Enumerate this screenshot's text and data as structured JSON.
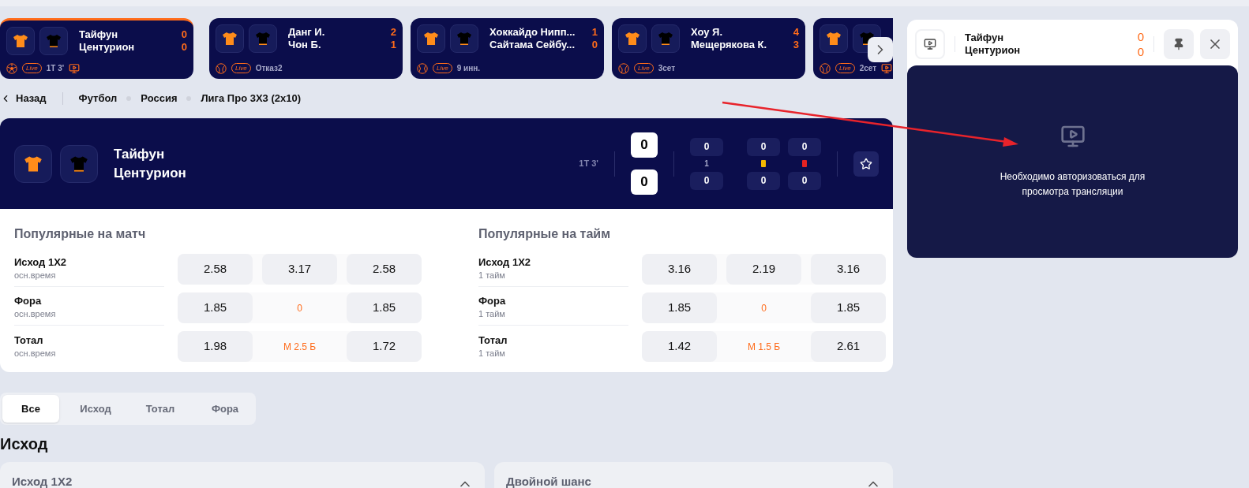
{
  "ticker": [
    {
      "home": "Тайфун",
      "away": "Центурион",
      "home_score": "0",
      "away_score": "0",
      "kind": "football",
      "live": "Live",
      "status": "1T 3'",
      "tv": true,
      "selected": true
    },
    {
      "home": "Данг И.",
      "away": "Чон Б.",
      "home_score": "2",
      "away_score": "1",
      "kind": "tennis",
      "live": "Live",
      "status": "Отказ2",
      "tv": false,
      "selected": false
    },
    {
      "home": "Хоккайдо Нипп...",
      "away": "Сайтама Сейбу...",
      "home_score": "1",
      "away_score": "0",
      "kind": "baseball",
      "live": "Live",
      "status": "9 инн.",
      "tv": false,
      "selected": false
    },
    {
      "home": "Хоу Я.",
      "away": "Мещерякова К.",
      "home_score": "4",
      "away_score": "3",
      "kind": "tennis",
      "live": "Live",
      "status": "3сет",
      "tv": false,
      "selected": false
    },
    {
      "kind": "tennis",
      "live": "Live",
      "status": "2сет",
      "tv": true,
      "selected": false
    }
  ],
  "breadcrumb": {
    "back": "Назад",
    "items": [
      "Футбол",
      "Россия",
      "Лига Про 3Х3 (2х10)"
    ]
  },
  "match": {
    "home": "Тайфун",
    "away": "Центурион",
    "time": "1T 3'",
    "home_score": "0",
    "away_score": "0",
    "stats": [
      {
        "kind": "text",
        "label": "1",
        "home": "0",
        "away": "0"
      },
      {
        "kind": "card",
        "color": "#f5b800",
        "home": "0",
        "away": "0"
      },
      {
        "kind": "card",
        "color": "#e52222",
        "home": "0",
        "away": "0"
      }
    ]
  },
  "popular": [
    {
      "title": "Популярные на матч",
      "rows": [
        {
          "market": "Исход 1X2",
          "period": "осн.время",
          "odds": [
            {
              "kind": "odd",
              "value": "2.58"
            },
            {
              "kind": "odd",
              "value": "3.17"
            },
            {
              "kind": "odd",
              "value": "2.58"
            }
          ]
        },
        {
          "market": "Фора",
          "period": "осн.время",
          "odds": [
            {
              "kind": "odd",
              "value": "1.85"
            },
            {
              "kind": "line",
              "value": "0"
            },
            {
              "kind": "odd",
              "value": "1.85"
            }
          ]
        },
        {
          "market": "Тотал",
          "period": "осн.время",
          "odds": [
            {
              "kind": "odd",
              "value": "1.98"
            },
            {
              "kind": "line",
              "value": "М 2.5 Б"
            },
            {
              "kind": "odd",
              "value": "1.72"
            }
          ]
        }
      ]
    },
    {
      "title": "Популярные на тайм",
      "rows": [
        {
          "market": "Исход 1X2",
          "period": "1 тайм",
          "odds": [
            {
              "kind": "odd",
              "value": "3.16"
            },
            {
              "kind": "odd",
              "value": "2.19"
            },
            {
              "kind": "odd",
              "value": "3.16"
            }
          ]
        },
        {
          "market": "Фора",
          "period": "1 тайм",
          "odds": [
            {
              "kind": "odd",
              "value": "1.85"
            },
            {
              "kind": "line",
              "value": "0"
            },
            {
              "kind": "odd",
              "value": "1.85"
            }
          ]
        },
        {
          "market": "Тотал",
          "period": "1 тайм",
          "odds": [
            {
              "kind": "odd",
              "value": "1.42"
            },
            {
              "kind": "line",
              "value": "М 1.5 Б"
            },
            {
              "kind": "odd",
              "value": "2.61"
            }
          ]
        }
      ]
    }
  ],
  "tabs": [
    {
      "label": "Все",
      "selected": true
    },
    {
      "label": "Исход",
      "selected": false
    },
    {
      "label": "Тотал",
      "selected": false
    },
    {
      "label": "Фора",
      "selected": false
    }
  ],
  "section_title": "Исход",
  "markets": [
    {
      "title": "Исход 1X2",
      "expanded": true
    },
    {
      "title": "Двойной шанс",
      "expanded": true
    }
  ],
  "stream": {
    "home": "Тайфун",
    "away": "Центурион",
    "home_score": "0",
    "away_score": "0",
    "message": "Необходимо авторизоваться для просмотра трансляции"
  }
}
